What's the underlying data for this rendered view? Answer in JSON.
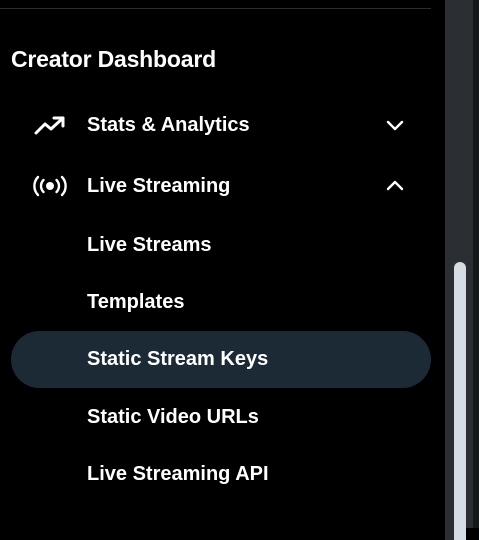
{
  "sidebar": {
    "section_title": "Creator Dashboard",
    "groups": [
      {
        "label": "Stats & Analytics",
        "icon": "trending-up-icon",
        "state": "collapsed"
      },
      {
        "label": "Live Streaming",
        "icon": "broadcast-icon",
        "state": "expanded"
      }
    ],
    "live_streaming_items": [
      {
        "label": "Live Streams",
        "active": false
      },
      {
        "label": "Templates",
        "active": false
      },
      {
        "label": "Static Stream Keys",
        "active": true
      },
      {
        "label": "Static Video URLs",
        "active": false
      },
      {
        "label": "Live Streaming API",
        "active": false
      }
    ]
  },
  "colors": {
    "background": "#000000",
    "text": "#ffffff",
    "active_item_bg": "#1c2a35",
    "scroll_track": "#2b2f33",
    "scroll_thumb": "#d6dde4"
  }
}
